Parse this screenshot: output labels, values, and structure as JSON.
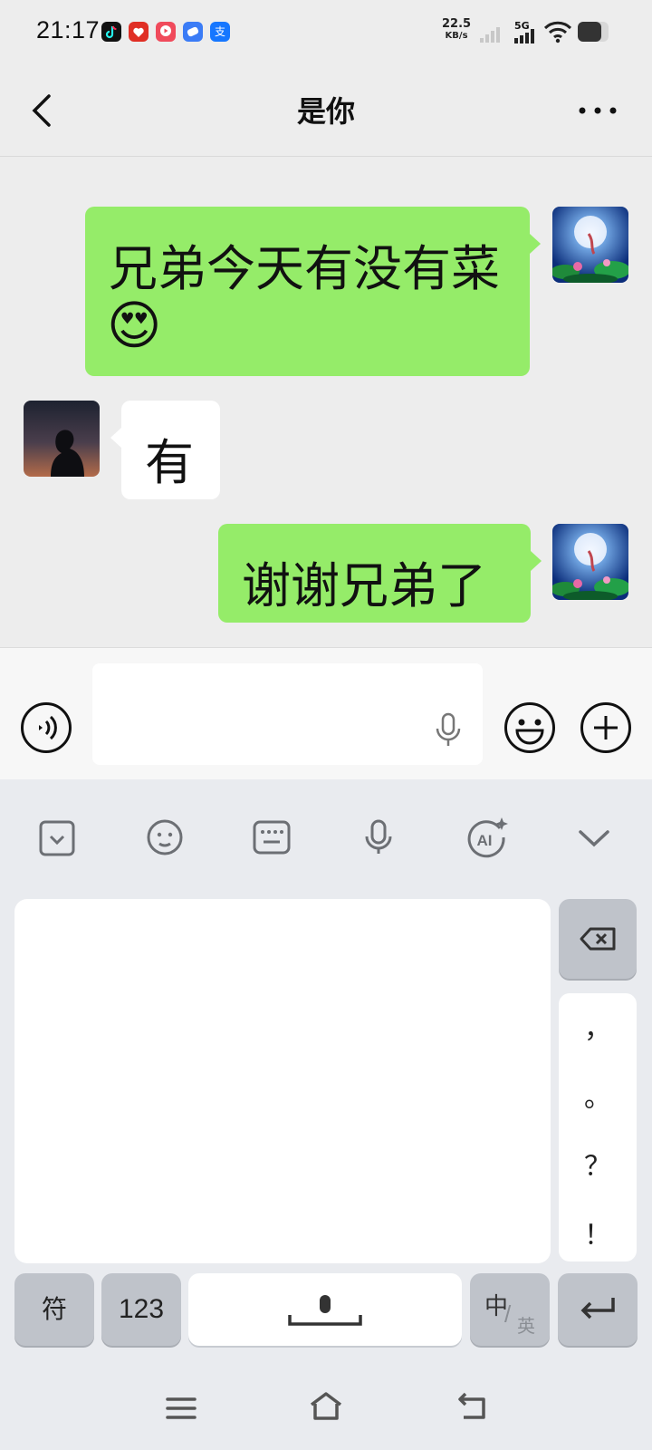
{
  "status_bar": {
    "time": "21:17",
    "net_speed_value": "22.5",
    "net_speed_unit": "KB/s",
    "cellular": "5G",
    "app_icons": [
      "douyin-icon",
      "pinduoduo-icon",
      "video-app-icon",
      "browser-icon",
      "alipay-icon"
    ]
  },
  "header": {
    "title": "是你",
    "back_icon": "chevron-left-icon",
    "more_icon": "more-icon"
  },
  "messages": [
    {
      "side": "right",
      "text": "兄弟今天有没有菜",
      "emoji": "😍"
    },
    {
      "side": "left",
      "text": "有"
    },
    {
      "side": "right",
      "text": "谢谢兄弟了"
    }
  ],
  "input_bar": {
    "placeholder": "",
    "value": ""
  },
  "keyboard": {
    "toolbar_icons": [
      "collapse-icon",
      "emoji-icon",
      "keyboard-icon",
      "mic-icon",
      "ai-icon",
      "chevron-down-icon"
    ],
    "punctuation": [
      "，",
      "。",
      "？",
      "！"
    ],
    "keys": {
      "symbols": "符",
      "numbers": "123",
      "lang_main": "中",
      "lang_alt": "英"
    }
  },
  "colors": {
    "sent_bubble": "#95ec69",
    "received_bubble": "#ffffff",
    "chat_background": "#ededed"
  }
}
